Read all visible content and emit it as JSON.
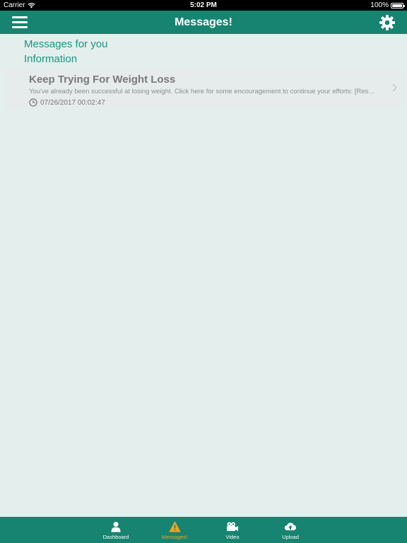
{
  "status_bar": {
    "carrier": "Carrier",
    "time": "5:02 PM",
    "battery": "100%"
  },
  "nav": {
    "title": "Messages!",
    "menu_icon": "hamburger-menu-icon",
    "settings_icon": "gear-icon"
  },
  "sections": {
    "messages_for_you": "Messages for you",
    "information": "Information"
  },
  "message": {
    "title": "Keep Trying For Weight Loss",
    "body": "You've already been successful at losing weight. Click here for some encouragement to continue your efforts: [Resources]",
    "timestamp": "07/26/2017 00:02:47"
  },
  "tabs": [
    {
      "label": "Dashboard",
      "icon": "person-icon",
      "active": false
    },
    {
      "label": "Messages!",
      "icon": "warning-icon",
      "active": true
    },
    {
      "label": "Video",
      "icon": "video-camera-icon",
      "active": false
    },
    {
      "label": "Upload",
      "icon": "cloud-upload-icon",
      "active": false
    }
  ],
  "colors": {
    "primary": "#168470",
    "accent": "#f3a21c",
    "section_text": "#1d9480",
    "background": "#e4eeec"
  }
}
